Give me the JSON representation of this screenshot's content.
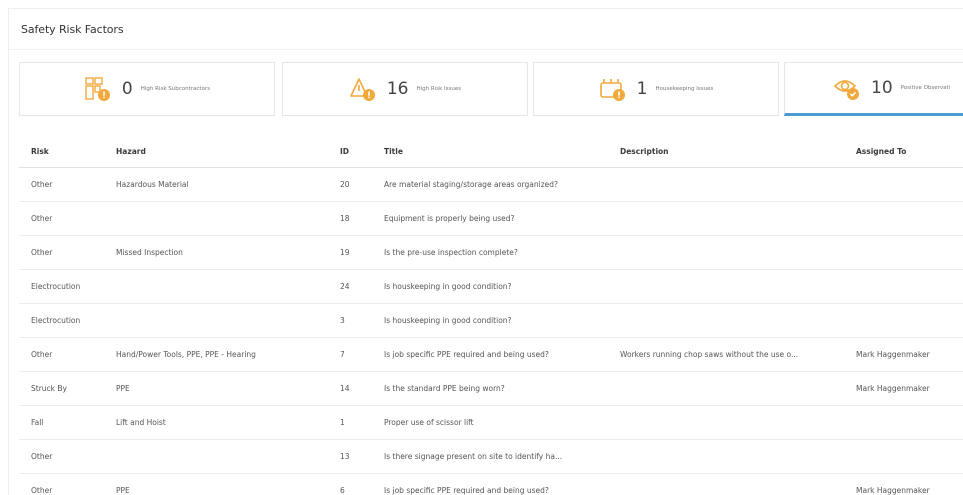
{
  "panel": {
    "title": "Safety Risk Factors"
  },
  "cards": [
    {
      "icon": "subcontractor-icon",
      "value": "0",
      "label": "High Risk Subcontractors"
    },
    {
      "icon": "warning-triangle-icon",
      "value": "16",
      "label": "High Risk Issues"
    },
    {
      "icon": "housekeeping-icon",
      "value": "1",
      "label": "Housekeeping Issues"
    },
    {
      "icon": "eye-icon",
      "value": "10",
      "label": "Positive Observati"
    }
  ],
  "colors": {
    "accent_orange": "#f2a93b",
    "active_tab_underline": "#4a9bd2"
  },
  "table": {
    "headers": {
      "risk": "Risk",
      "hazard": "Hazard",
      "id": "ID",
      "title": "Title",
      "description": "Description",
      "assigned_to": "Assigned To"
    },
    "rows": [
      {
        "risk": "Other",
        "hazard": "Hazardous Material",
        "id": "20",
        "title": "Are material staging/storage areas organized?",
        "description": "",
        "assigned_to": ""
      },
      {
        "risk": "Other",
        "hazard": "",
        "id": "18",
        "title": "Equipment is properly being used?",
        "description": "",
        "assigned_to": ""
      },
      {
        "risk": "Other",
        "hazard": "Missed Inspection",
        "id": "19",
        "title": "Is the pre-use inspection complete?",
        "description": "",
        "assigned_to": ""
      },
      {
        "risk": "Electrocution",
        "hazard": "",
        "id": "24",
        "title": "Is houskeeping in good condition?",
        "description": "",
        "assigned_to": ""
      },
      {
        "risk": "Electrocution",
        "hazard": "",
        "id": "3",
        "title": "Is houskeeping in good condition?",
        "description": "",
        "assigned_to": ""
      },
      {
        "risk": "Other",
        "hazard": "Hand/Power Tools, PPE, PPE - Hearing",
        "id": "7",
        "title": "Is job specific PPE required and being used?",
        "description": "Workers running chop saws without the use o...",
        "assigned_to": "Mark Haggenmaker"
      },
      {
        "risk": "Struck By",
        "hazard": "PPE",
        "id": "14",
        "title": "Is the standard PPE being worn?",
        "description": "",
        "assigned_to": "Mark Haggenmaker"
      },
      {
        "risk": "Fall",
        "hazard": "Lift and Hoist",
        "id": "1",
        "title": "Proper use of scissor lift",
        "description": "",
        "assigned_to": ""
      },
      {
        "risk": "Other",
        "hazard": "",
        "id": "13",
        "title": "Is there signage present on site to identify ha...",
        "description": "",
        "assigned_to": ""
      },
      {
        "risk": "Other",
        "hazard": "PPE",
        "id": "6",
        "title": "Is job specific PPE required and being used?",
        "description": "",
        "assigned_to": "Mark Haggenmaker"
      }
    ]
  }
}
